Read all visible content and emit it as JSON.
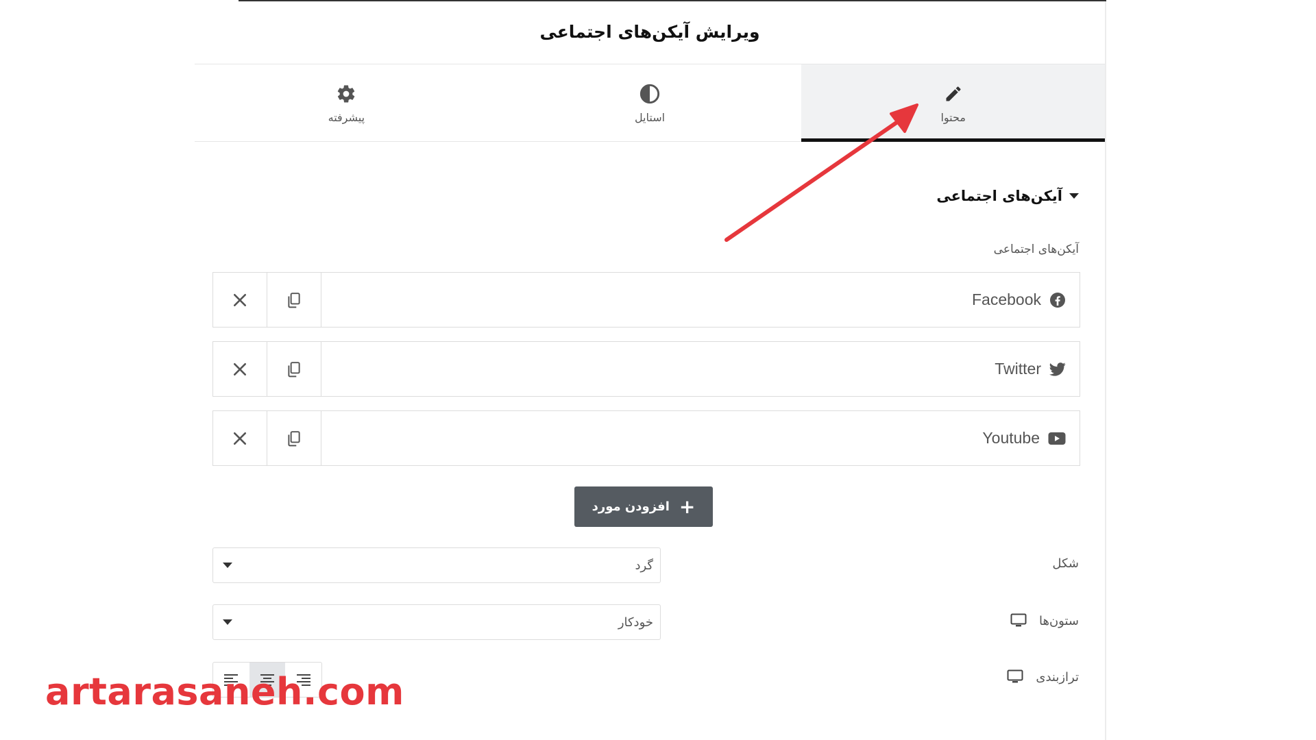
{
  "panel": {
    "title": "ویرایش آیکن‌های اجتماعی"
  },
  "tabs": [
    {
      "label": "محتوا",
      "icon": "pencil-icon",
      "active": true
    },
    {
      "label": "استایل",
      "icon": "half-circle-icon",
      "active": false
    },
    {
      "label": "پیشرفته",
      "icon": "gear-icon",
      "active": false
    }
  ],
  "section": {
    "title": "آیکن‌های اجتماعی",
    "field_label": "آیکن‌های اجتماعی"
  },
  "social_items": [
    {
      "title": "Facebook",
      "icon": "facebook-icon"
    },
    {
      "title": "Twitter",
      "icon": "twitter-icon"
    },
    {
      "title": "Youtube",
      "icon": "youtube-icon"
    }
  ],
  "add_button": {
    "label": "افزودن مورد"
  },
  "controls": {
    "shape": {
      "label": "شکل",
      "value": "گرد"
    },
    "columns": {
      "label": "ستون‌ها",
      "value": "خودکار",
      "device_icon": "desktop-icon"
    },
    "alignment": {
      "label": "ترازبندی",
      "device_icon": "desktop-icon",
      "options": [
        "left",
        "center",
        "right"
      ],
      "selected": "center"
    }
  },
  "annotation": {
    "color": "#e6373c"
  },
  "watermark": {
    "text": "artarasaneh.com"
  }
}
